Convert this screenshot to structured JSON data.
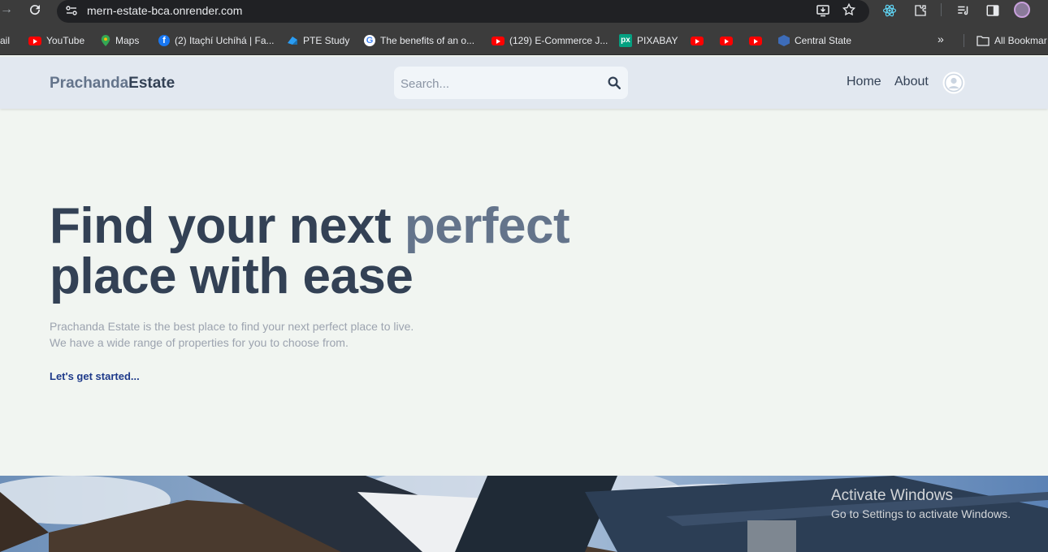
{
  "browser": {
    "url": "mern-estate-bca.onrender.com",
    "bookmarks_cut_left": "ail",
    "bookmarks": [
      {
        "label": "YouTube",
        "icon": "youtube-icon"
      },
      {
        "label": "Maps",
        "icon": "maps-icon"
      },
      {
        "label": "(2) Itaçhí Uchíhá | Fa...",
        "icon": "facebook-icon"
      },
      {
        "label": "PTE Study",
        "icon": "pte-icon"
      },
      {
        "label": "The benefits of an o...",
        "icon": "google-icon"
      },
      {
        "label": "(129) E-Commerce J...",
        "icon": "youtube-icon"
      },
      {
        "label": "PIXABAY",
        "icon": "pixabay-icon"
      },
      {
        "label": "Central State",
        "icon": "central-state-icon"
      }
    ],
    "more_bookmarks": "»",
    "all_bookmarks": "All Bookmar"
  },
  "header": {
    "logo_part1": "Prachanda",
    "logo_part2": "Estate",
    "search_placeholder": "Search...",
    "nav": {
      "home": "Home",
      "about": "About"
    }
  },
  "hero": {
    "title_line1_a": "Find your next ",
    "title_line1_b": "perfect",
    "title_line2": "place with ease",
    "desc_line1": "Prachanda Estate is the best place to find your next perfect place to live.",
    "desc_line2": "We have a wide range of properties for you to choose from.",
    "cta": "Let's get started..."
  },
  "watermark": {
    "line1": "Activate Windows",
    "line2": "Go to Settings to activate Windows."
  },
  "colors": {
    "page_bg": "#f1f5f1",
    "header_bg": "#e2e8f0",
    "title": "#334155",
    "accent": "#64748b",
    "cta": "#1e3a8a"
  }
}
